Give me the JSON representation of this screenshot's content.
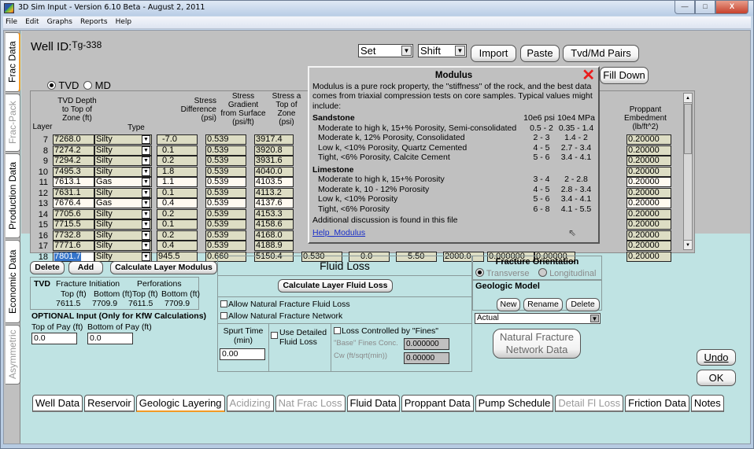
{
  "window": {
    "title": "3D Sim Input - Version 6.10 Beta - August 2, 2011",
    "buttons": {
      "minimize": "—",
      "maximize": "□",
      "close": "X"
    }
  },
  "menu": [
    "File",
    "Edit",
    "Graphs",
    "Reports",
    "Help"
  ],
  "side_tabs": [
    {
      "label": "Frac Data",
      "state": "active"
    },
    {
      "label": "Frac-Pack",
      "state": "disabled"
    },
    {
      "label": "Production Data",
      "state": "normal"
    },
    {
      "label": "Economic Data",
      "state": "normal"
    },
    {
      "label": "Asymmetric",
      "state": "disabled"
    }
  ],
  "header": {
    "well_id_label": "Well ID:",
    "well_id_value": "Tg-338",
    "set_combo": "Set",
    "shift_combo": "Shift",
    "import_btn": "Import",
    "paste_btn": "Paste",
    "pairs_btn": "Tvd/Md Pairs",
    "fill_down_btn": "Fill Down",
    "tvd_label": "TVD",
    "md_label": "MD",
    "depth_mode": "TVD"
  },
  "grid": {
    "headers": {
      "layer": "Layer",
      "tvd": [
        "TVD Depth",
        "to Top of",
        "Zone (ft)"
      ],
      "type": "Type",
      "stress_diff": [
        "Stress",
        "Difference",
        "(psi)"
      ],
      "gradient": [
        "Stress",
        "Gradient",
        "from Surface",
        "(psi/ft)"
      ],
      "stress_top": [
        "Stress a",
        "Top of",
        "Zone",
        "(psi)"
      ],
      "proppant": [
        "Proppant",
        "Embedment",
        "(lb/ft^2)"
      ]
    },
    "rows": [
      {
        "layer": "7",
        "tvd": "7268.0",
        "type": "Silty",
        "diff": "-7.0",
        "grad": "0.539",
        "stress": "3917.4",
        "prop": "0.20000"
      },
      {
        "layer": "8",
        "tvd": "7274.2",
        "type": "Silty",
        "diff": "0.1",
        "grad": "0.539",
        "stress": "3920.8",
        "prop": "0.20000"
      },
      {
        "layer": "9",
        "tvd": "7294.2",
        "type": "Silty",
        "diff": "0.2",
        "grad": "0.539",
        "stress": "3931.6",
        "prop": "0.20000"
      },
      {
        "layer": "10",
        "tvd": "7495.3",
        "type": "Silty",
        "diff": "1.8",
        "grad": "0.539",
        "stress": "4040.0",
        "prop": "0.20000"
      },
      {
        "layer": "11",
        "tvd": "7613.1",
        "type": "Gas",
        "diff": "1.1",
        "grad": "0.539",
        "stress": "4103.5",
        "prop": "0.20000"
      },
      {
        "layer": "12",
        "tvd": "7631.1",
        "type": "Silty",
        "diff": "0.1",
        "grad": "0.539",
        "stress": "4113.2",
        "prop": "0.20000"
      },
      {
        "layer": "13",
        "tvd": "7676.4",
        "type": "Gas",
        "diff": "0.4",
        "grad": "0.539",
        "stress": "4137.6",
        "prop": "0.20000"
      },
      {
        "layer": "14",
        "tvd": "7705.6",
        "type": "Silty",
        "diff": "0.2",
        "grad": "0.539",
        "stress": "4153.3",
        "prop": "0.20000"
      },
      {
        "layer": "15",
        "tvd": "7715.5",
        "type": "Silty",
        "diff": "0.1",
        "grad": "0.539",
        "stress": "4158.6",
        "prop": "0.20000"
      },
      {
        "layer": "16",
        "tvd": "7732.8",
        "type": "Silty",
        "diff": "0.2",
        "grad": "0.539",
        "stress": "4168.0",
        "prop": "0.20000"
      },
      {
        "layer": "17",
        "tvd": "7771.6",
        "type": "Silty",
        "diff": "0.4",
        "grad": "0.539",
        "stress": "4188.9",
        "prop": "0.20000"
      },
      {
        "layer": "18",
        "tvd": "7801.7",
        "type": "Silty",
        "diff": "945.5",
        "grad": "0.660",
        "stress": "5150.4",
        "prop": "0.20000"
      }
    ],
    "row18_extra": [
      "0.530",
      "0.0",
      "5.50",
      "2000.0",
      "0.000000",
      "0.00000"
    ]
  },
  "modulus_popup": {
    "title": "Modulus",
    "intro": "Modulus is a pure rock property, the \"stiffness\" of the rock, and the best data comes from triaxial compression tests on core samples. Typical values might include:",
    "col_a": "10e6 psi",
    "col_b": "10e4 MPa",
    "sections": [
      {
        "name": "Sandstone",
        "rows": [
          {
            "desc": "Moderate to high k, 15+% Porosity, Semi-consolidated",
            "a": "0.5 - 2",
            "b": "0.35 - 1.4"
          },
          {
            "desc": "Moderate k, 12% Porosity, Consolidated",
            "a": "2 - 3",
            "b": "1.4 - 2"
          },
          {
            "desc": "Low k, <10% Porosity, Quartz Cemented",
            "a": "4 - 5",
            "b": "2.7 - 3.4"
          },
          {
            "desc": "Tight, <6% Porosity, Calcite Cement",
            "a": "5 - 6",
            "b": "3.4 - 4.1"
          }
        ]
      },
      {
        "name": "Limestone",
        "rows": [
          {
            "desc": "Moderate to high k, 15+% Porosity",
            "a": "3 - 4",
            "b": "2 - 2.8"
          },
          {
            "desc": "Moderate k, 10 - 12% Porosity",
            "a": "4 - 5",
            "b": "2.8 - 3.4"
          },
          {
            "desc": "Low k, <10% Porosity",
            "a": "5 - 6",
            "b": "3.4 - 4.1"
          },
          {
            "desc": "Tight, <6% Porosity",
            "a": "6 - 8",
            "b": "4.1 - 5.5"
          }
        ]
      }
    ],
    "footer": "Additional discussion is found in this file",
    "link": "Help_Modulus"
  },
  "layer_buttons": {
    "delete": "Delete",
    "add": "Add",
    "calc_modulus": "Calculate Layer Modulus"
  },
  "perf_box": {
    "tvd": "TVD",
    "frac_init": "Fracture Initiation",
    "perforations": "Perforations",
    "top": "Top (ft)",
    "bottom": "Bottom (ft)",
    "fi_top": "7611.5",
    "fi_bottom": "7709.9",
    "pf_top": "7611.5",
    "pf_bottom": "7709.9"
  },
  "optional": {
    "title": "OPTIONAL Input (Only for KfW Calculations)",
    "top_pay_label": "Top of Pay (ft)",
    "bottom_pay_label": "Bottom of Pay (ft)",
    "top_pay": "0.0",
    "bottom_pay": "0.0"
  },
  "fluid_loss": {
    "title": "Fluid Loss",
    "calc_btn": "Calculate Layer Fluid Loss",
    "allow_nf_loss": "Allow Natural Fracture Fluid Loss",
    "allow_nf_network": "Allow Natural Fracture Network",
    "spurt_label": "Spurt Time (min)",
    "spurt_value": "0.00",
    "detailed": "Use Detailed Fluid Loss",
    "fines": "Loss Controlled by \"Fines\"",
    "base_fines_label": "\"Base\" Fines Conc.",
    "base_fines_value": "0.000000",
    "cw_label": "Cw (ft/sqrt(min))",
    "cw_value": "0.00000"
  },
  "fracture_orientation": {
    "title": "Fracture Orientation",
    "transverse": "Transverse",
    "longitudinal": "Longitudinal",
    "selected": "Transverse"
  },
  "geologic_model": {
    "title": "Geologic Model",
    "new": "New",
    "rename": "Rename",
    "delete": "Delete",
    "selected": "Actual"
  },
  "nf_network_btn": "Natural Fracture Network Data",
  "undo_btn": "Undo",
  "ok_btn": "OK",
  "bottom_tabs": [
    {
      "label": "Well Data",
      "state": "normal"
    },
    {
      "label": "Reservoir",
      "state": "normal"
    },
    {
      "label": "Geologic Layering",
      "state": "active"
    },
    {
      "label": "Acidizing",
      "state": "disabled"
    },
    {
      "label": "Nat Frac Loss",
      "state": "disabled"
    },
    {
      "label": "Fluid Data",
      "state": "normal"
    },
    {
      "label": "Proppant Data",
      "state": "normal"
    },
    {
      "label": "Pump Schedule",
      "state": "normal"
    },
    {
      "label": "Detail Fl Loss",
      "state": "disabled"
    },
    {
      "label": "Friction Data",
      "state": "normal"
    },
    {
      "label": "Notes",
      "state": "normal"
    }
  ]
}
